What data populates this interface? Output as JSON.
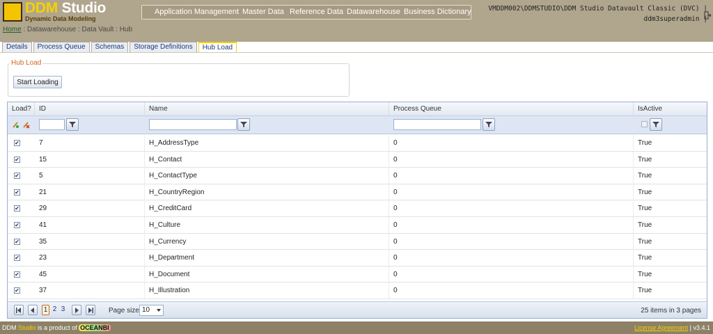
{
  "header": {
    "logo_title_prefix": "DDM",
    "logo_title_suffix": "Studio",
    "logo_subtitle": "Dynamic Data Modeling",
    "nav": [
      "Application Management",
      "Master Data",
      "Reference Data",
      "Datawarehouse",
      "Business Dictionary"
    ],
    "server_info": "VMDDM002\\DDMSTUDIO\\DDM Studio Datavault Classic (DVC) |",
    "user": "ddm3superadmin |"
  },
  "breadcrumb": {
    "home": "Home",
    "rest": " : Datawarehouse : Data Vault : Hub"
  },
  "tabs": [
    {
      "label": "Details",
      "active": false
    },
    {
      "label": "Process Queue",
      "active": false
    },
    {
      "label": "Schemas",
      "active": false
    },
    {
      "label": "Storage Definitions",
      "active": false
    },
    {
      "label": "Hub Load",
      "active": true
    }
  ],
  "hub_load": {
    "legend": "Hub Load",
    "start_button": "Start Loading"
  },
  "grid": {
    "columns": [
      "Load?",
      "ID",
      "Name",
      "Process Queue",
      "IsActive"
    ],
    "rows": [
      {
        "load": true,
        "id": "7",
        "name": "H_AddressType",
        "queue": "0",
        "active": "True"
      },
      {
        "load": true,
        "id": "15",
        "name": "H_Contact",
        "queue": "0",
        "active": "True"
      },
      {
        "load": true,
        "id": "5",
        "name": "H_ContactType",
        "queue": "0",
        "active": "True"
      },
      {
        "load": true,
        "id": "21",
        "name": "H_CountryRegion",
        "queue": "0",
        "active": "True"
      },
      {
        "load": true,
        "id": "29",
        "name": "H_CreditCard",
        "queue": "0",
        "active": "True"
      },
      {
        "load": true,
        "id": "41",
        "name": "H_Culture",
        "queue": "0",
        "active": "True"
      },
      {
        "load": true,
        "id": "35",
        "name": "H_Currency",
        "queue": "0",
        "active": "True"
      },
      {
        "load": true,
        "id": "23",
        "name": "H_Department",
        "queue": "0",
        "active": "True"
      },
      {
        "load": true,
        "id": "45",
        "name": "H_Document",
        "queue": "0",
        "active": "True"
      },
      {
        "load": true,
        "id": "37",
        "name": "H_Illustration",
        "queue": "0",
        "active": "True"
      }
    ],
    "pager": {
      "pages": [
        "1",
        "2",
        "3"
      ],
      "current_page": "1",
      "page_size_label": "Page size:",
      "page_size": "10",
      "items_info": "25 items in 3 pages"
    }
  },
  "footer": {
    "left_prefix": "DDM",
    "left_studio": "Studio",
    "left_suffix": " is a product of ",
    "brand": "OCEANBI",
    "license": "License Agreement",
    "version": "| v3.4.1"
  },
  "colors": {
    "header_bg": "#b0a58d",
    "logo_yellow": "#f5c400",
    "accent_orange": "#cc6a1f",
    "grid_border": "#9aaed0",
    "footer_bg": "#8c8066"
  }
}
